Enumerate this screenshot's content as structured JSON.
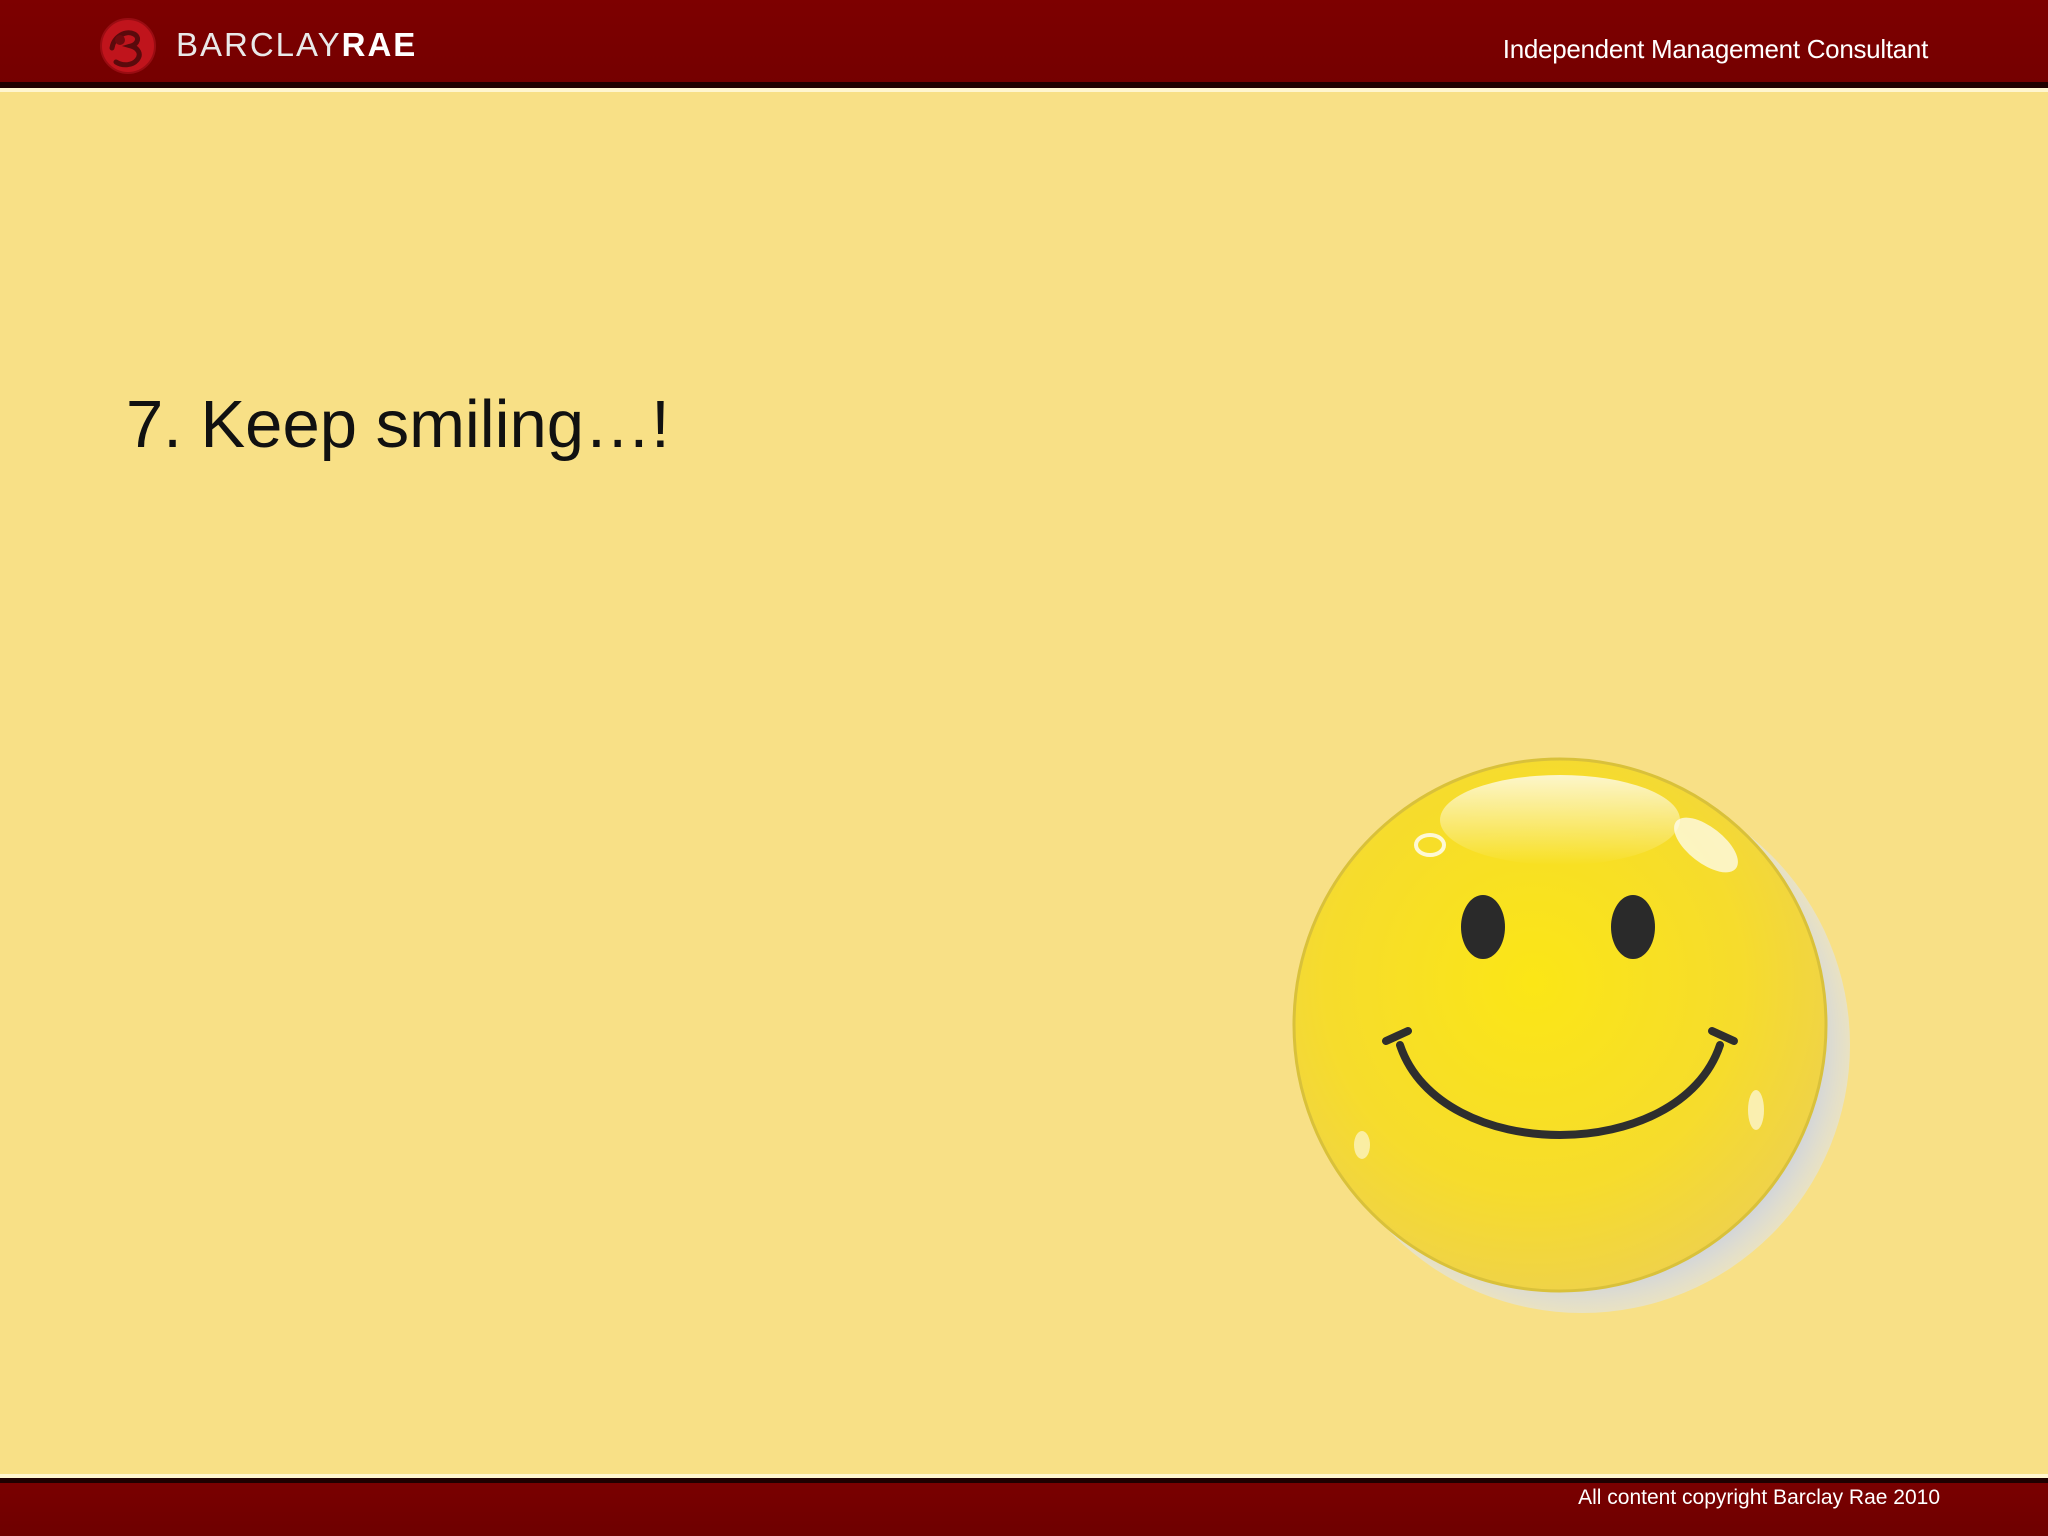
{
  "header": {
    "brand_light": "BARCLAY",
    "brand_bold": "RAE",
    "tagline": "Independent Management Consultant"
  },
  "slide": {
    "title": "7. Keep smiling…!",
    "image_icon": "smiley-face-icon"
  },
  "footer": {
    "copyright": "All content copyright Barclay Rae 2010"
  },
  "colors": {
    "background": "#f8e086",
    "header_bar": "#7d0000",
    "smiley_yellow": "#f9e12a"
  }
}
